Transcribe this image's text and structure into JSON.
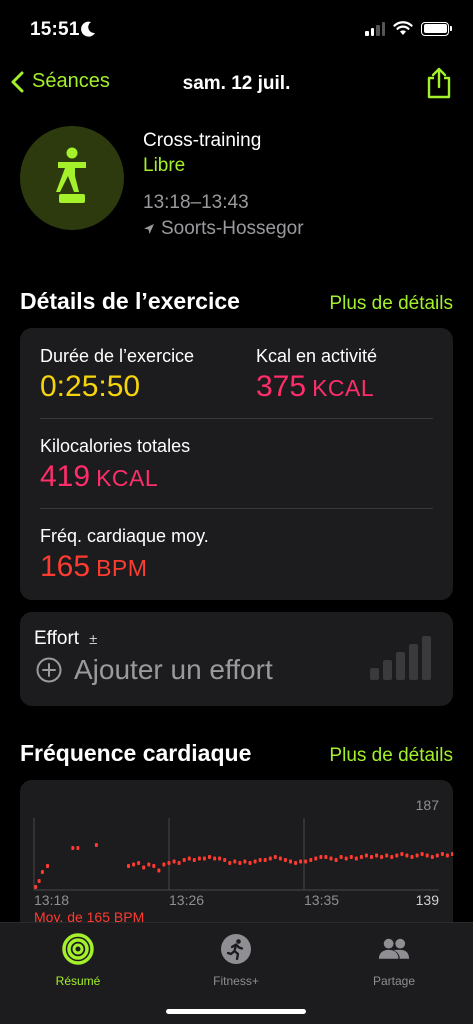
{
  "status_bar": {
    "time": "15:51"
  },
  "nav": {
    "back_label": "Séances",
    "title": "sam. 12 juil."
  },
  "workout": {
    "name": "Cross-training",
    "type": "Libre",
    "time_range": "13:18–13:43",
    "location": "Soorts-Hossegor"
  },
  "details": {
    "title": "Détails de l’exercice",
    "more_link": "Plus de détails",
    "duration_label": "Durée de l’exercice",
    "duration_value": "0:25:50",
    "active_kcal_label": "Kcal en activité",
    "active_kcal_value": "375",
    "active_kcal_unit": "KCAL",
    "total_kcal_label": "Kilocalories totales",
    "total_kcal_value": "419",
    "total_kcal_unit": "KCAL",
    "hr_label": "Fréq. cardiaque moy.",
    "hr_value": "165",
    "hr_unit": "BPM"
  },
  "effort": {
    "label": "Effort",
    "add_label": "Ajouter un effort"
  },
  "heart_rate": {
    "title": "Fréquence cardiaque",
    "more_link": "Plus de détails",
    "avg_text": "Moy. de 165 BPM"
  },
  "chart_data": {
    "type": "scatter",
    "x_ticks": [
      "13:18",
      "13:26",
      "13:35"
    ],
    "y_max_label": "187",
    "y_min_label": "139",
    "ylim": [
      139,
      187
    ],
    "color": "#ff3b30",
    "x_minutes_after_start": [
      0.1,
      0.3,
      0.5,
      0.8,
      2.3,
      2.6,
      3.7,
      5.6,
      5.9,
      6.2,
      6.5,
      6.8,
      7.1,
      7.4,
      7.7,
      8.0,
      8.3,
      8.6,
      8.9,
      9.2,
      9.5,
      9.8,
      10.1,
      10.4,
      10.7,
      11.0,
      11.3,
      11.6,
      11.9,
      12.2,
      12.5,
      12.8,
      13.1,
      13.4,
      13.7,
      14.0,
      14.3,
      14.6,
      14.9,
      15.2,
      15.5,
      15.8,
      16.1,
      16.4,
      16.7,
      17.0,
      17.3,
      17.6,
      17.9,
      18.2,
      18.5,
      18.8,
      19.1,
      19.4,
      19.7,
      20.0,
      20.3,
      20.6,
      20.9,
      21.2,
      21.5,
      21.8,
      22.1,
      22.4,
      22.7,
      23.0,
      23.3,
      23.6,
      23.9,
      24.2,
      24.5,
      24.8,
      25.1,
      25.4
    ],
    "values": [
      141,
      145,
      151,
      155,
      167,
      167,
      169,
      155,
      156,
      157,
      154,
      156,
      155,
      152,
      156,
      157,
      158,
      157,
      159,
      160,
      159,
      160,
      160,
      161,
      160,
      160,
      159,
      157,
      158,
      157,
      158,
      157,
      158,
      159,
      159,
      160,
      161,
      160,
      159,
      158,
      157,
      158,
      158,
      159,
      160,
      161,
      161,
      160,
      159,
      161,
      160,
      161,
      160,
      161,
      162,
      161,
      162,
      161,
      162,
      161,
      162,
      163,
      162,
      161,
      162,
      163,
      162,
      161,
      162,
      163,
      162,
      163,
      163,
      164
    ]
  },
  "tab_bar": {
    "tabs": [
      {
        "label": "Résumé"
      },
      {
        "label": "Fitness+"
      },
      {
        "label": "Partage"
      }
    ]
  },
  "colors": {
    "accent": "#a3f02b",
    "duration": "#f5d40e",
    "kcal": "#ff2d6a",
    "heart": "#ff3b30"
  }
}
